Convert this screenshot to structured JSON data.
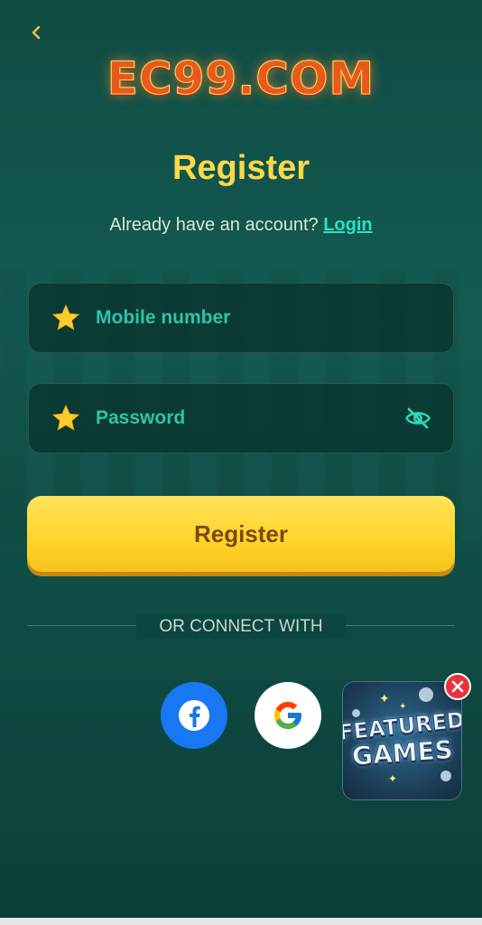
{
  "header": {
    "logo_text": "EC99.COM"
  },
  "page": {
    "title": "Register",
    "account_prompt": "Already have an account?",
    "login_link": "Login"
  },
  "form": {
    "mobile_placeholder": "Mobile number",
    "password_placeholder": "Password",
    "submit_label": "Register"
  },
  "social": {
    "divider_text": "OR CONNECT WITH",
    "providers": [
      "facebook",
      "google"
    ]
  },
  "promo": {
    "line1": "FEATURED",
    "line2": "GAMES"
  },
  "colors": {
    "accent_yellow": "#ffd84a",
    "link_teal": "#2fe0c6",
    "button_text": "#7a4a12",
    "facebook_blue": "#1877f2",
    "close_red": "#e8323c"
  }
}
